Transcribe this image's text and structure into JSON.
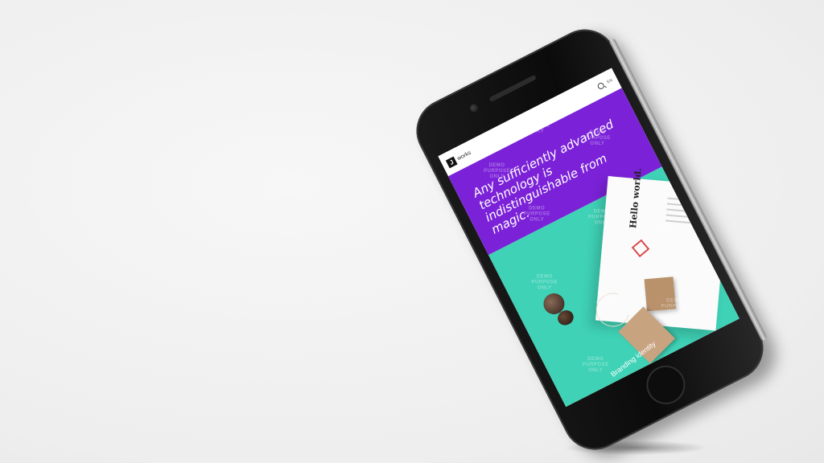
{
  "site": {
    "logo_mark": "J",
    "logo_text": "works",
    "lang": "EN",
    "hero_quote": "Any sufficiently advanced technology is indistinguishable from magic.",
    "paper_heading": "Hello world.",
    "caption": "Branding identity"
  },
  "colors": {
    "hero_bg": "#7b22d8",
    "mockup_bg": "#3fd2b6"
  },
  "icons": {
    "search": "search-icon"
  },
  "watermark": {
    "line1": "DEMO",
    "line2": "PURPOSE",
    "line3": "ONLY"
  }
}
